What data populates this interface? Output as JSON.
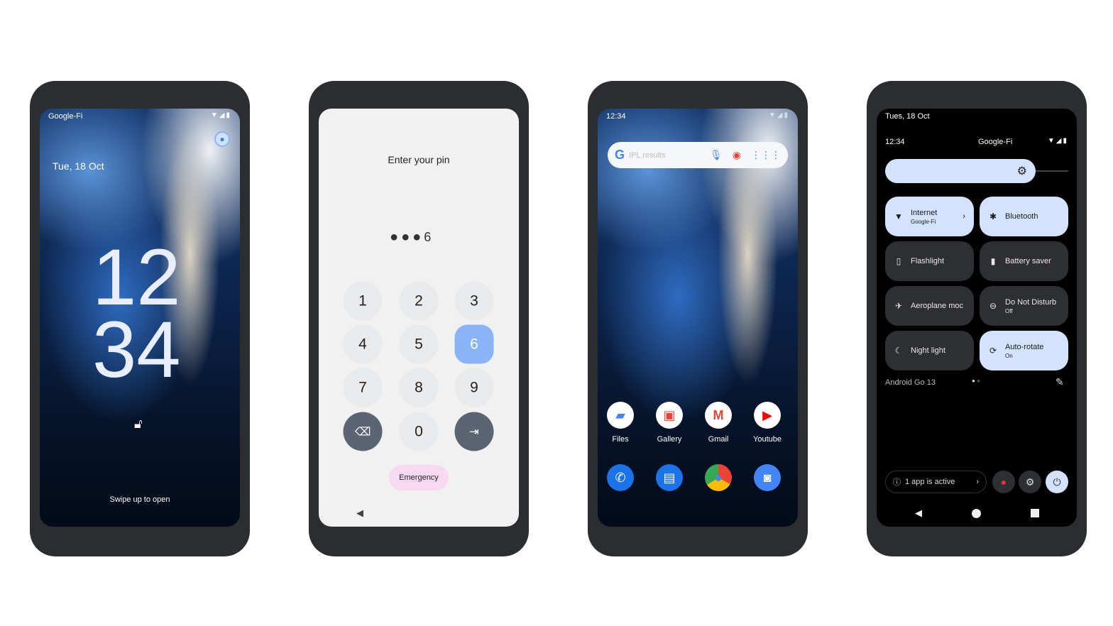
{
  "lock": {
    "carrier": "Google-Fi",
    "date": "Tue, 18 Oct",
    "hour": "12",
    "minute": "34",
    "hint": "Swipe up to open",
    "icons": [
      "wifi-icon",
      "signal-icon",
      "battery-icon",
      "user-icon",
      "lock-icon"
    ]
  },
  "pin": {
    "title": "Enter your pin",
    "entry": "6",
    "keys": [
      "1",
      "2",
      "3",
      "4",
      "5",
      "6",
      "7",
      "8",
      "9",
      "0"
    ],
    "emergency": "Emergency",
    "highlight_key": "6",
    "accent": "#8ab4f8"
  },
  "home": {
    "time": "12:34",
    "search_placeholder": "IPL results",
    "apps": [
      {
        "label": "Files"
      },
      {
        "label": "Gallery"
      },
      {
        "label": "Gmail"
      },
      {
        "label": "Youtube"
      }
    ],
    "dock": [
      "phone-icon",
      "messages-icon",
      "chrome-icon",
      "camera-icon"
    ]
  },
  "qs": {
    "date": "Tues, 18 Oct",
    "time": "12:34",
    "carrier": "Google-Fi",
    "brightness": 0.8,
    "tiles": [
      {
        "label": "Internet",
        "sub": "Google-Fi",
        "on": true,
        "icon": "wifi-icon"
      },
      {
        "label": "Bluetooth",
        "sub": "",
        "on": true,
        "icon": "bluetooth-icon"
      },
      {
        "label": "Flashlight",
        "sub": "",
        "on": false,
        "icon": "flashlight-icon"
      },
      {
        "label": "Battery saver",
        "sub": "",
        "on": false,
        "icon": "battery-saver-icon"
      },
      {
        "label": "Aeroplane moc",
        "sub": "",
        "on": false,
        "icon": "airplane-icon"
      },
      {
        "label": "Do Not Disturb",
        "sub": "Off",
        "on": false,
        "icon": "dnd-icon"
      },
      {
        "label": "Night light",
        "sub": "",
        "on": false,
        "icon": "moon-icon"
      },
      {
        "label": "Auto-rotate",
        "sub": "On",
        "on": true,
        "icon": "rotate-icon"
      }
    ],
    "build": "Android Go 13",
    "active_apps": "1 app is active",
    "accent": "#d3e3fd"
  }
}
